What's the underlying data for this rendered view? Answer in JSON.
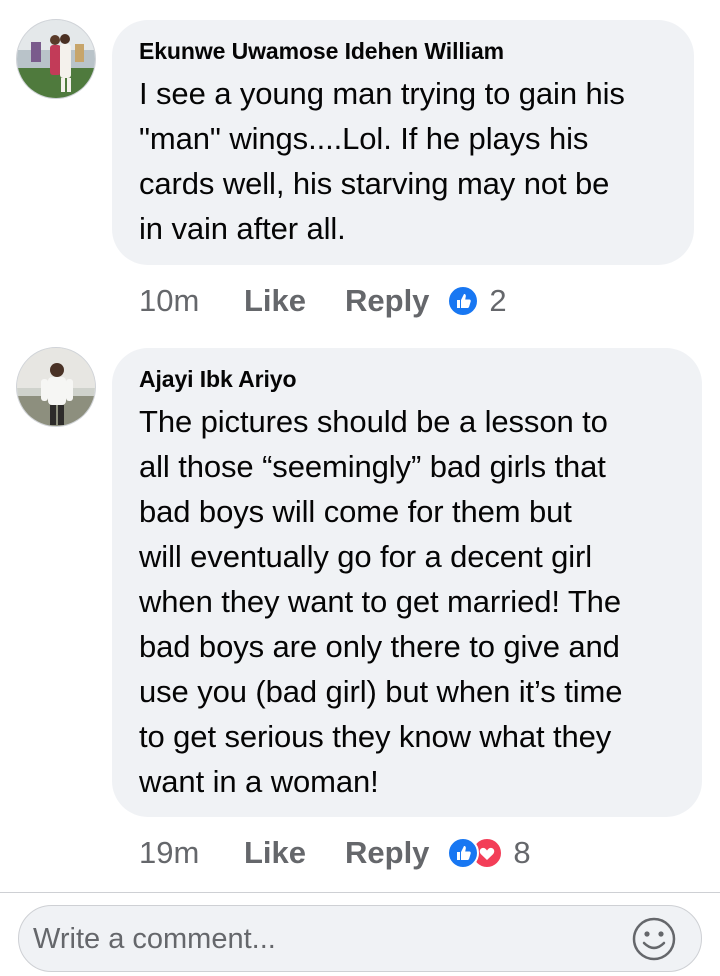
{
  "comments": [
    {
      "author": "Ekunwe Uwamose Idehen William",
      "text": "I see a young man trying to gain his\n\"man\" wings....Lol.  If he plays his\ncards well, his starving may not be\nin vain after all.",
      "time": "10m",
      "like_label": "Like",
      "reply_label": "Reply",
      "reactions": [
        "like"
      ],
      "reaction_count": "2"
    },
    {
      "author": "Ajayi Ibk Ariyo",
      "text": "The pictures should be a lesson to\nall those “seemingly” bad girls that\nbad boys will come for them but\nwill eventually go for a decent girl\nwhen they want to get married! The\nbad boys are only there to give and\nuse you (bad girl) but when it’s time\nto get serious they know what they\nwant in a woman!",
      "time": "19m",
      "like_label": "Like",
      "reply_label": "Reply",
      "reactions": [
        "like",
        "love"
      ],
      "reaction_count": "8"
    }
  ],
  "composer": {
    "placeholder": "Write a comment...",
    "emoji_icon": "smiley-icon"
  },
  "colors": {
    "bubble": "#f0f2f5",
    "meta_text": "#65676b",
    "like_blue": "#1877f2",
    "love_red": "#f33e58"
  }
}
